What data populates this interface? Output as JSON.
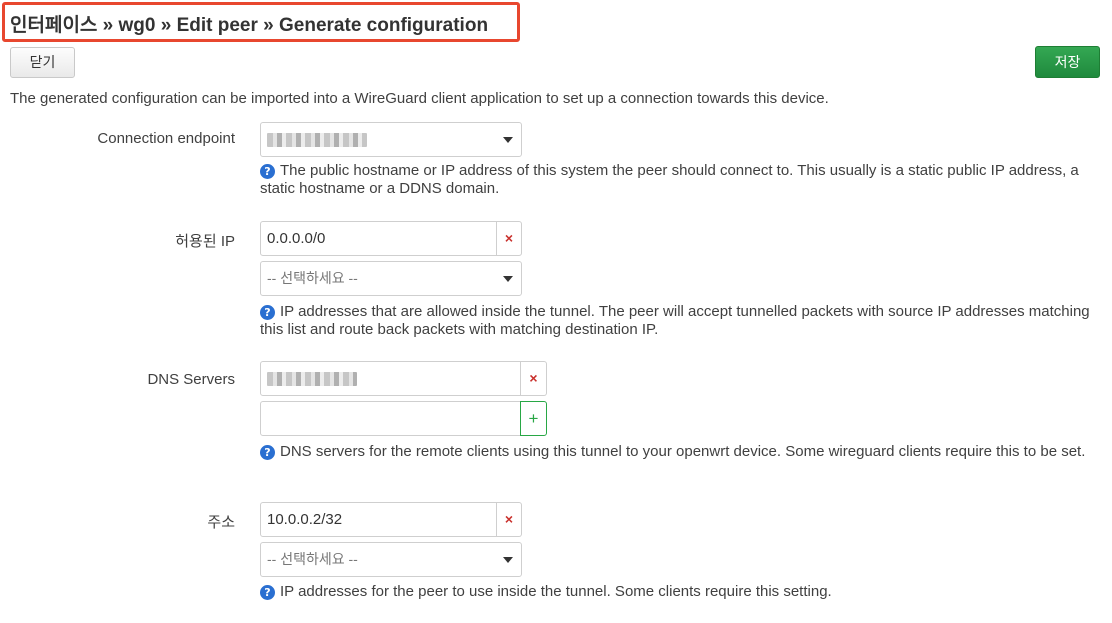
{
  "header": {
    "title": "인터페이스 » wg0 » Edit peer » Generate configuration",
    "close_label": "닫기",
    "save_label": "저장",
    "description": "The generated configuration can be imported into a WireGuard client application to set up a connection towards this device."
  },
  "colors": {
    "highlight_border": "#e8472f",
    "save_button": "#1f8a3d",
    "remove_icon": "#c9302c",
    "add_icon": "#28a745",
    "help_icon": "#2a6fd1"
  },
  "fields": {
    "endpoint": {
      "label": "Connection endpoint",
      "value_redacted": true,
      "help": "The public hostname or IP address of this system the peer should connect to. This usually is a static public IP address, a static hostname or a DDNS domain."
    },
    "allowed_ips": {
      "label": "허용된 IP",
      "value": "0.0.0.0/0",
      "select_placeholder": "-- 선택하세요 --",
      "help": "IP addresses that are allowed inside the tunnel. The peer will accept tunnelled packets with source IP addresses matching this list and route back packets with matching destination IP."
    },
    "dns_servers": {
      "label": "DNS Servers",
      "value_redacted": true,
      "new_value": "",
      "help": "DNS servers for the remote clients using this tunnel to your openwrt device. Some wireguard clients require this to be set."
    },
    "address": {
      "label": "주소",
      "value": "10.0.0.2/32",
      "select_placeholder": "-- 선택하세요 --",
      "help": "IP addresses for the peer to use inside the tunnel. Some clients require this setting."
    }
  },
  "icons": {
    "remove": "×",
    "add": "+",
    "help": "?"
  }
}
